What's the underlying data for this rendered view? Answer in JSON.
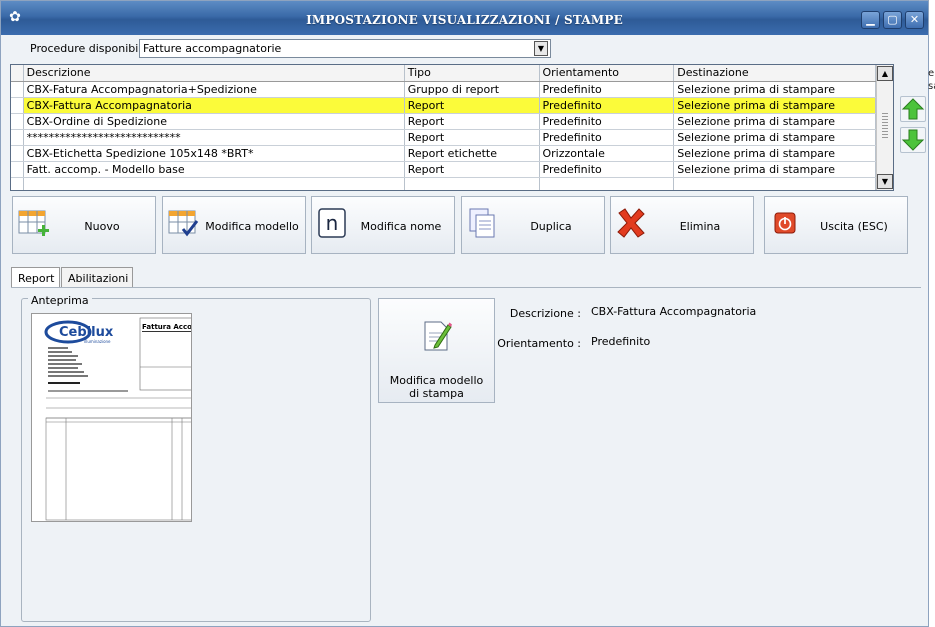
{
  "window": {
    "title": "IMPOSTAZIONE VISUALIZZAZIONI / STAMPE",
    "min": "▁",
    "max": "▢",
    "close": "✕"
  },
  "procedure": {
    "label": "Procedure disponibili :",
    "selected": "Fatture accompagnatorie"
  },
  "grid": {
    "columns": [
      "Descrizione",
      "Tipo",
      "Orientamento",
      "Destinazione"
    ],
    "rows": [
      [
        "CBX-Fatura Accompagnatoria+Spedizione",
        "Gruppo di report",
        "Predefinito",
        "Selezione prima di stampare"
      ],
      [
        "CBX-Fattura Accompagnatoria",
        "Report",
        "Predefinito",
        "Selezione prima di stampare"
      ],
      [
        "CBX-Ordine di Spedizione",
        "Report",
        "Predefinito",
        "Selezione prima di stampare"
      ],
      [
        "****************************",
        "Report",
        "Predefinito",
        "Selezione prima di stampare"
      ],
      [
        "CBX-Etichetta Spedizione 105x148 *BRT*",
        "Report etichette",
        "Orizzontale",
        "Selezione prima di stampare"
      ],
      [
        "Fatt. accomp. - Modello base",
        "Report",
        "Predefinito",
        "Selezione prima di stampare"
      ],
      [
        "",
        "",
        "",
        ""
      ]
    ],
    "selected_row": 1,
    "highlight_color": "#fbfb3a"
  },
  "toolbar": {
    "nuovo": "Nuovo",
    "modifica_modello": "Modifica modello",
    "modifica_nome": "Modifica nome",
    "duplica": "Duplica",
    "elimina": "Elimina",
    "uscita": "Uscita (ESC)",
    "icon_letter": "n"
  },
  "tabs": [
    "Report",
    "Abilitazioni"
  ],
  "preview": {
    "legend": "Anteprima",
    "logo_text": "Cebilux",
    "logo_sub": "illuminazione",
    "doc_title": "Fattura Accomp"
  },
  "details": {
    "edit_button": "Modifica modello di stampa",
    "descrizione_label": "Descrizione :",
    "descrizione_value": "CBX-Fattura Accompagnatoria",
    "orientamento_label": "Orientamento :",
    "orientamento_value": "Predefinito"
  },
  "cut_text": [
    "er",
    "sa"
  ]
}
